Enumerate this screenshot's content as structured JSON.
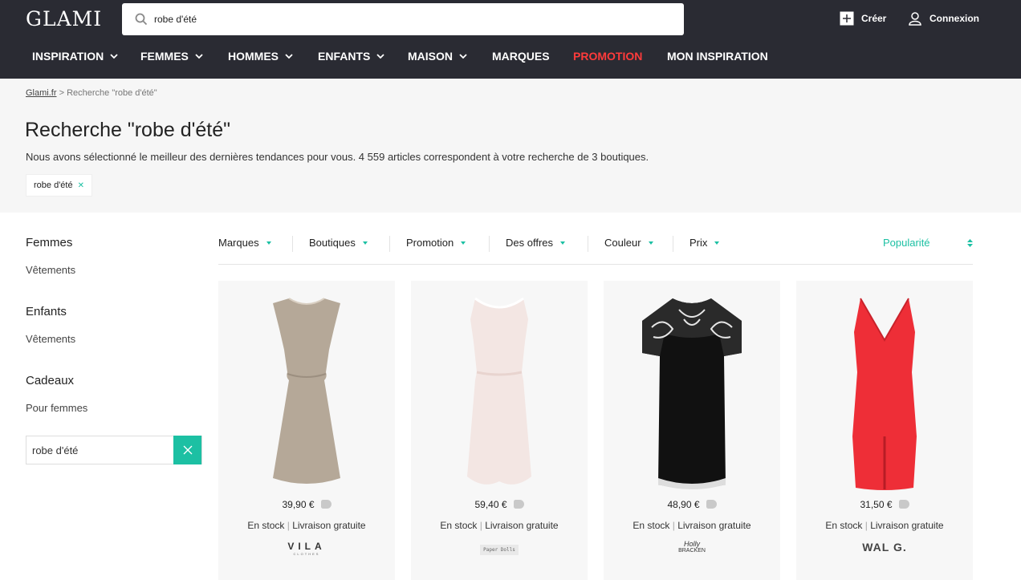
{
  "header": {
    "logo": "GLAMI",
    "search_value": "robe d'été",
    "create_label": "Créer",
    "login_label": "Connexion"
  },
  "nav": [
    {
      "label": "INSPIRATION",
      "dropdown": true
    },
    {
      "label": "FEMMES",
      "dropdown": true
    },
    {
      "label": "HOMMES",
      "dropdown": true
    },
    {
      "label": "ENFANTS",
      "dropdown": true
    },
    {
      "label": "MAISON",
      "dropdown": true
    },
    {
      "label": "MARQUES",
      "dropdown": false
    },
    {
      "label": "PROMOTION",
      "dropdown": false,
      "color": "#ff3b3b"
    },
    {
      "label": "MON INSPIRATION",
      "dropdown": false
    }
  ],
  "breadcrumb": {
    "home": "Glami.fr",
    "separator": ">",
    "current": "Recherche \"robe d'été\""
  },
  "page": {
    "title": "Recherche \"robe d'été\"",
    "subtitle": "Nous avons sélectionné le meilleur des dernières tendances pour vous. 4 559 articles correspondent à votre recherche de 3 boutiques.",
    "tag": "robe d'été"
  },
  "sidebar": {
    "sections": [
      {
        "title": "Femmes",
        "link": "Vêtements"
      },
      {
        "title": "Enfants",
        "link": "Vêtements"
      },
      {
        "title": "Cadeaux",
        "link": "Pour femmes"
      }
    ],
    "search_value": "robe d'été"
  },
  "filters": [
    "Marques",
    "Boutiques",
    "Promotion",
    "Des offres",
    "Couleur",
    "Prix"
  ],
  "sort_label": "Popularité",
  "products": [
    {
      "price": "39,90 €",
      "stock": "En stock",
      "delivery": "Livraison gratuite",
      "brand": "VILA",
      "brand_sub": "CLOTHES",
      "dress_color": "#b5a898"
    },
    {
      "price": "59,40 €",
      "stock": "En stock",
      "delivery": "Livraison gratuite",
      "brand": "Paper Dolls",
      "brand_sub": "",
      "dress_color": "#f3e6e3"
    },
    {
      "price": "48,90 €",
      "stock": "En stock",
      "delivery": "Livraison gratuite",
      "brand": "Holly",
      "brand_sub": "BRACKEN",
      "dress_color": "#111111"
    },
    {
      "price": "31,50 €",
      "stock": "En stock",
      "delivery": "Livraison gratuite",
      "brand": "WAL G.",
      "brand_sub": "",
      "dress_color": "#ee2e37"
    }
  ],
  "colors": {
    "accent": "#1cc0a3",
    "topbar": "#2a2b33",
    "promo": "#ff3b3b"
  }
}
